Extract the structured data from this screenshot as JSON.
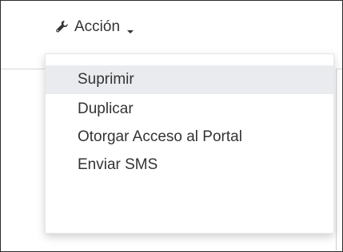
{
  "toolbar": {
    "action_label": "Acción",
    "icon": "wrench-icon",
    "caret": "caret-down-icon"
  },
  "menu": {
    "items": [
      {
        "label": "Suprimir",
        "active": true
      },
      {
        "label": "Duplicar",
        "active": false
      },
      {
        "label": "Otorgar Acceso al Portal",
        "active": false
      },
      {
        "label": "Enviar SMS",
        "active": false
      }
    ]
  }
}
